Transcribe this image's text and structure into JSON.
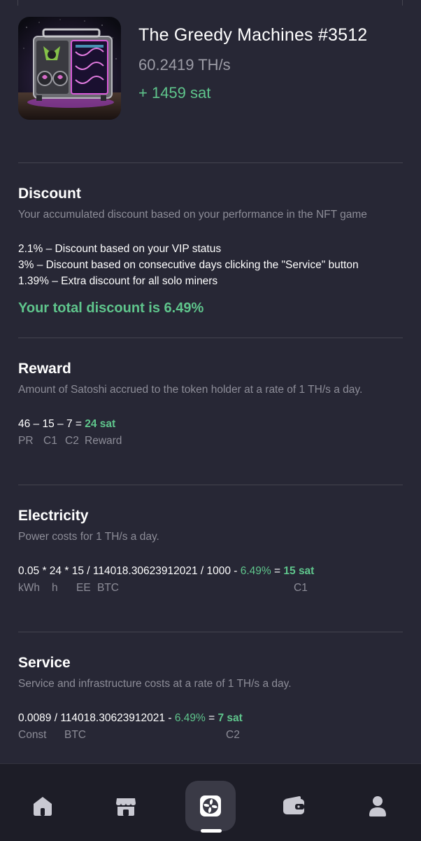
{
  "nft": {
    "title": "The Greedy Machines #3512",
    "hashrate": "60.2419 TH/s",
    "gain": "+ 1459 sat"
  },
  "discount": {
    "title": "Discount",
    "description": "Your accumulated discount based on your performance in the NFT game",
    "items": [
      "2.1% – Discount based on your VIP status",
      "3% – Discount based on consecutive days clicking the \"Service\" button",
      "1.39% – Extra discount for all solo miners"
    ],
    "total": "Your total discount is 6.49%"
  },
  "reward": {
    "title": "Reward",
    "description": "Amount of Satoshi accrued to the token holder at a rate of 1 TH/s a day.",
    "formula": "46 – 15 – 7 =",
    "result": "24 sat",
    "labels": {
      "pr": "PR",
      "c1": "C1",
      "c2": "C2",
      "reward": "Reward"
    }
  },
  "electricity": {
    "title": "Electricity",
    "description": "Power costs for 1 TH/s a day.",
    "formula": "0.05 * 24 * 15 / 114018.30623912021 / 1000 -",
    "discount": "6.49%",
    "equals": "=",
    "result": "15 sat",
    "labels": {
      "kwh": "kWh",
      "h": "h",
      "ee": "EE",
      "btc": "BTC",
      "c1": "C1"
    }
  },
  "service": {
    "title": "Service",
    "description": "Service and infrastructure costs at a rate of 1 TH/s a day.",
    "formula": "0.0089 / 114018.30623912021 -",
    "discount": "6.49%",
    "equals": "=",
    "result": "7 sat",
    "labels": {
      "const": "Const",
      "btc": "BTC",
      "c2": "C2"
    }
  },
  "nav": {
    "items": [
      "home-icon",
      "store-icon",
      "fan-icon",
      "wallet-icon",
      "profile-icon"
    ],
    "active": "fan-icon"
  },
  "colors": {
    "background": "#272735",
    "accent_green": "#5fc58c",
    "muted": "#8d8d98",
    "nav_background": "#1d1d27"
  }
}
